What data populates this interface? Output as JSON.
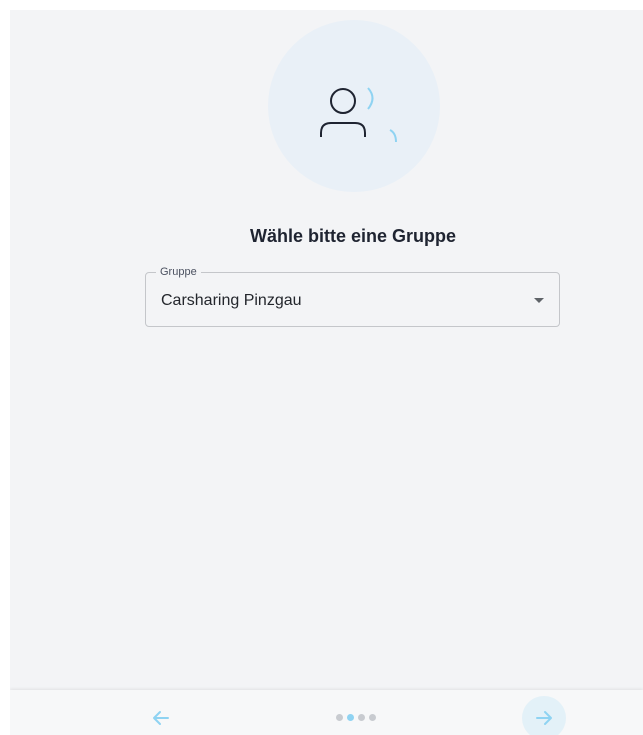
{
  "page": {
    "title": "Wähle bitte eine Gruppe"
  },
  "hero": {
    "icon": "person-group-icon",
    "accent_color": "#8fd3f2",
    "circle_color": "#e9f0f7"
  },
  "group_select": {
    "label": "Gruppe",
    "value": "Carsharing Pinzgau"
  },
  "footer": {
    "back_icon": "arrow-left-icon",
    "next_icon": "arrow-right-icon",
    "steps_total": 4,
    "current_step": 2,
    "active_color": "#8fd3f2"
  }
}
